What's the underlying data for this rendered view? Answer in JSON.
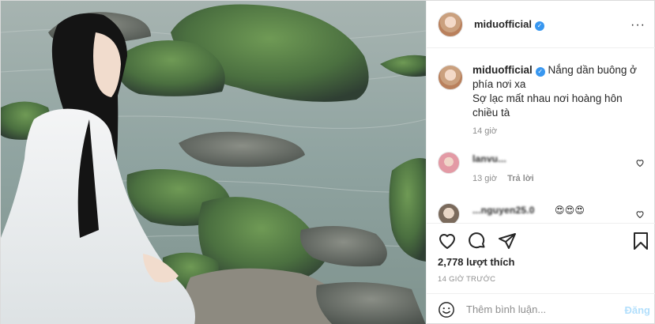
{
  "post": {
    "username": "miduofficial",
    "verified_mark": "✓",
    "more_icon": "more-options-icon",
    "caption": {
      "username": "miduofficial",
      "line1": "Nắng dần buông ở phía nơi xa",
      "line2": "Sợ lạc mất nhau nơi hoàng hôn chiều tà",
      "time": "14 giờ"
    },
    "comments": [
      {
        "user": "lanvu...",
        "text": "",
        "time": "13 giờ",
        "reply": "Trả lời"
      },
      {
        "user": "...nguyen25.0",
        "text": "😍😍😍",
        "time": "",
        "reply": ""
      }
    ],
    "likes": "2,778 lượt thích",
    "posted_ago": "14 GIỜ TRƯỚC",
    "comment_placeholder": "Thêm bình luận...",
    "post_button": "Đăng",
    "icons": [
      "heart-icon",
      "comment-icon",
      "share-icon",
      "bookmark-icon",
      "emoji-icon"
    ],
    "colors": {
      "verified": "#3897f0",
      "post_button_disabled": "#b2dffc",
      "muted": "#8e8e8e"
    }
  }
}
